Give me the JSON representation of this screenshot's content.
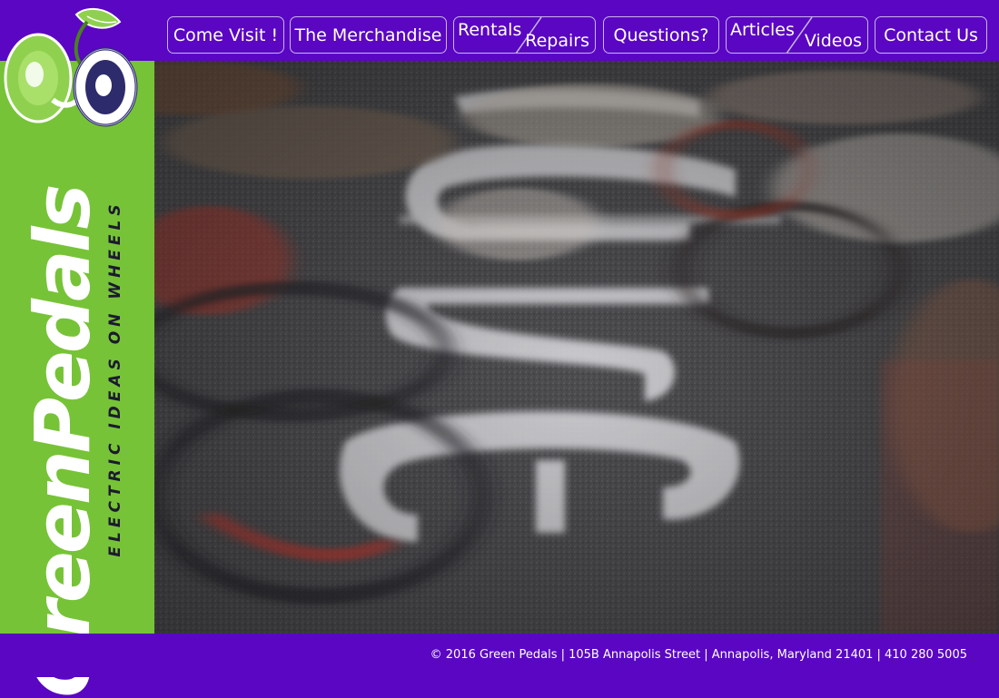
{
  "nav": {
    "items": [
      {
        "label": "Come Visit !"
      },
      {
        "label": "The Merchandise"
      },
      {
        "label_a": "Rentals",
        "label_b": "Repairs"
      },
      {
        "label": "Questions?"
      },
      {
        "label_a": "Articles",
        "label_b": "Videos"
      },
      {
        "label": "Contact Us"
      }
    ]
  },
  "sidebar": {
    "brand": "GreenPedals",
    "tagline": "ELECTRIC IDEAS ON WHEELS"
  },
  "hero": {
    "image": "blurred-bike-race-photo",
    "road_marking": "ane"
  },
  "footer": {
    "text": "© 2016 Green Pedals | 105B Annapolis Street | Annapolis, Maryland 21401 | 410 280 5005"
  },
  "colors": {
    "purple": "#5a06c3",
    "green": "#77c338",
    "white": "#ffffff"
  }
}
